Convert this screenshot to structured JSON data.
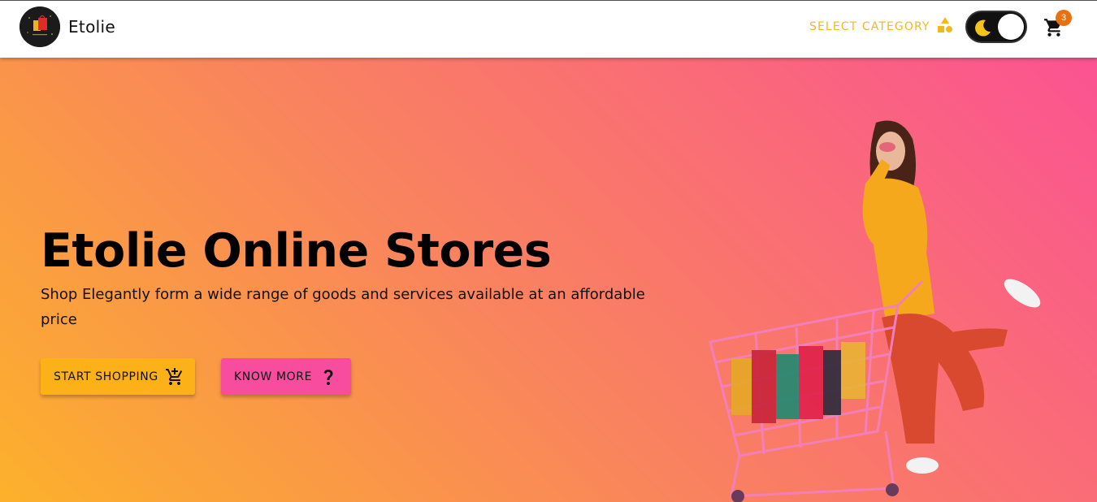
{
  "navbar": {
    "brand": "Etolie",
    "select_category": "SELECT CATEGORY",
    "cart_count": "3",
    "icons": [
      "shapes-icon",
      "moon-icon",
      "cart-icon"
    ]
  },
  "hero": {
    "title": "Etolie Online Stores",
    "subtitle": "Shop Elegantly form a wide range of goods and services available at an affordable price",
    "start_shopping_label": "START SHOPPING",
    "know_more_label": "KNOW MORE",
    "start_icon": "add-shopping-cart-icon",
    "know_icon": "question-mark-icon"
  },
  "colors": {
    "accent_yellow": "#f3b81b",
    "start_button": "#fbb117",
    "know_button": "#f84c9e",
    "badge": "#e8710d",
    "gradient_start": "#fcb12b",
    "gradient_end": "#fb5392"
  }
}
